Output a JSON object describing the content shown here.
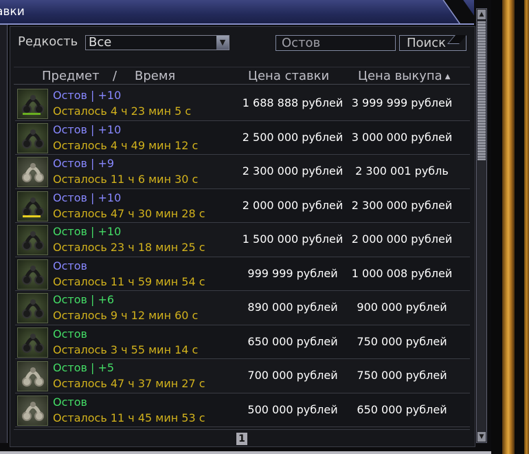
{
  "window": {
    "title": "авки"
  },
  "filter": {
    "rarity_label": "Редкость",
    "rarity_value": "Все",
    "search_value": "Остов",
    "search_button": "Поиск"
  },
  "columns": {
    "item": "Предмет",
    "divider": "/",
    "time": "Время",
    "bid": "Цена ставки",
    "buyout": "Цена выкупа"
  },
  "colors": {
    "blue_name": "#8888ff",
    "green_name": "#44dd66",
    "time": "#d2b21c"
  },
  "rows": [
    {
      "name": "Остов | +10",
      "name_color": "#8888ff",
      "time": "Осталось 4 ч 23 мин 5 с",
      "bid": "1 688 888 рублей",
      "buyout": "3 999 999 рублей",
      "icon": "dark-chain",
      "bar": "#6ab020"
    },
    {
      "name": "Остов | +10",
      "name_color": "#8888ff",
      "time": "Осталось 4 ч 49 мин 12 с",
      "bid": "2 500 000 рублей",
      "buyout": "3 000 000 рублей",
      "icon": "dark-chain",
      "bar": ""
    },
    {
      "name": "Остов | +9",
      "name_color": "#8888ff",
      "time": "Осталось 11 ч 6 мин 30 с",
      "bid": "2 300 000 рублей",
      "buyout": "2 300 001 рубль",
      "icon": "pale-chain",
      "bar": ""
    },
    {
      "name": "Остов | +10",
      "name_color": "#8888ff",
      "time": "Осталось 47 ч 30 мин 28 с",
      "bid": "2 000 000 рублей",
      "buyout": "2 300 000 рублей",
      "icon": "dark-chain",
      "bar": "#e8d020"
    },
    {
      "name": "Остов | +10",
      "name_color": "#44dd66",
      "time": "Осталось 23 ч 18 мин 25 с",
      "bid": "1 500 000 рублей",
      "buyout": "2 000 000 рублей",
      "icon": "dark-chain",
      "bar": ""
    },
    {
      "name": "Остов",
      "name_color": "#8888ff",
      "time": "Осталось 11 ч 59 мин 54 с",
      "bid": "999 999 рублей",
      "buyout": "1 000 008 рублей",
      "icon": "dark-chain",
      "bar": ""
    },
    {
      "name": "Остов | +6",
      "name_color": "#44dd66",
      "time": "Осталось 9 ч 12 мин 60 с",
      "bid": "890 000 рублей",
      "buyout": "900 000 рублей",
      "icon": "dark-chain",
      "bar": ""
    },
    {
      "name": "Остов",
      "name_color": "#44dd66",
      "time": "Осталось 3 ч 55 мин 14 с",
      "bid": "650 000 рублей",
      "buyout": "750 000 рублей",
      "icon": "dark-chain",
      "bar": ""
    },
    {
      "name": "Остов | +5",
      "name_color": "#44dd66",
      "time": "Осталось 47 ч 37 мин 27 с",
      "bid": "700 000 рублей",
      "buyout": "750 000 рублей",
      "icon": "pale-chain",
      "bar": ""
    },
    {
      "name": "Остов",
      "name_color": "#44dd66",
      "time": "Осталось 11 ч 45 мин 53 с",
      "bid": "500 000 рублей",
      "buyout": "650 000 рублей",
      "icon": "pale-chain",
      "bar": ""
    }
  ],
  "pagination": {
    "current": "1"
  }
}
